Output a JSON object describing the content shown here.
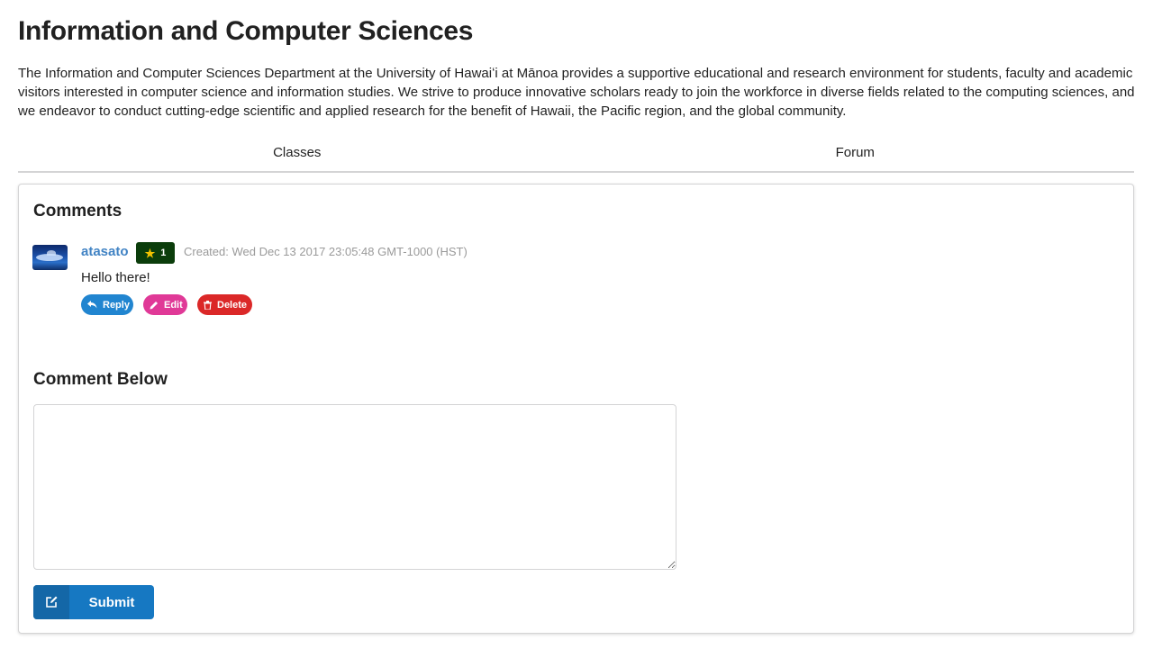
{
  "header": {
    "title": "Information and Computer Sciences",
    "description": "The Information and Computer Sciences Department at the University of Hawaiʻi at Mānoa provides a supportive educational and research environment for students, faculty and academic visitors interested in computer science and information studies. We strive to produce innovative scholars ready to join the workforce in diverse fields related to the computing sciences, and we endeavor to conduct cutting-edge scientific and applied research for the benefit of Hawaii, the Pacific region, and the global community."
  },
  "tabs": [
    {
      "label": "Classes"
    },
    {
      "label": "Forum"
    }
  ],
  "comments": {
    "title": "Comments",
    "items": [
      {
        "author": "atasato",
        "stars": "1",
        "created": "Created: Wed Dec 13 2017 23:05:48 GMT-1000 (HST)",
        "text": "Hello there!",
        "avatar_icon": "user-avatar-image",
        "actions": {
          "reply": "Reply",
          "edit": "Edit",
          "delete": "Delete"
        }
      }
    ]
  },
  "form": {
    "title": "Comment Below",
    "textarea_value": "",
    "submit_label": "Submit",
    "submit_icon": "edit-square-icon"
  },
  "colors": {
    "link": "#4183c4",
    "reply": "#2185d0",
    "edit": "#e03997",
    "delete": "#db2828",
    "badge": "#0b3d0b",
    "submit": "#1678c2"
  }
}
